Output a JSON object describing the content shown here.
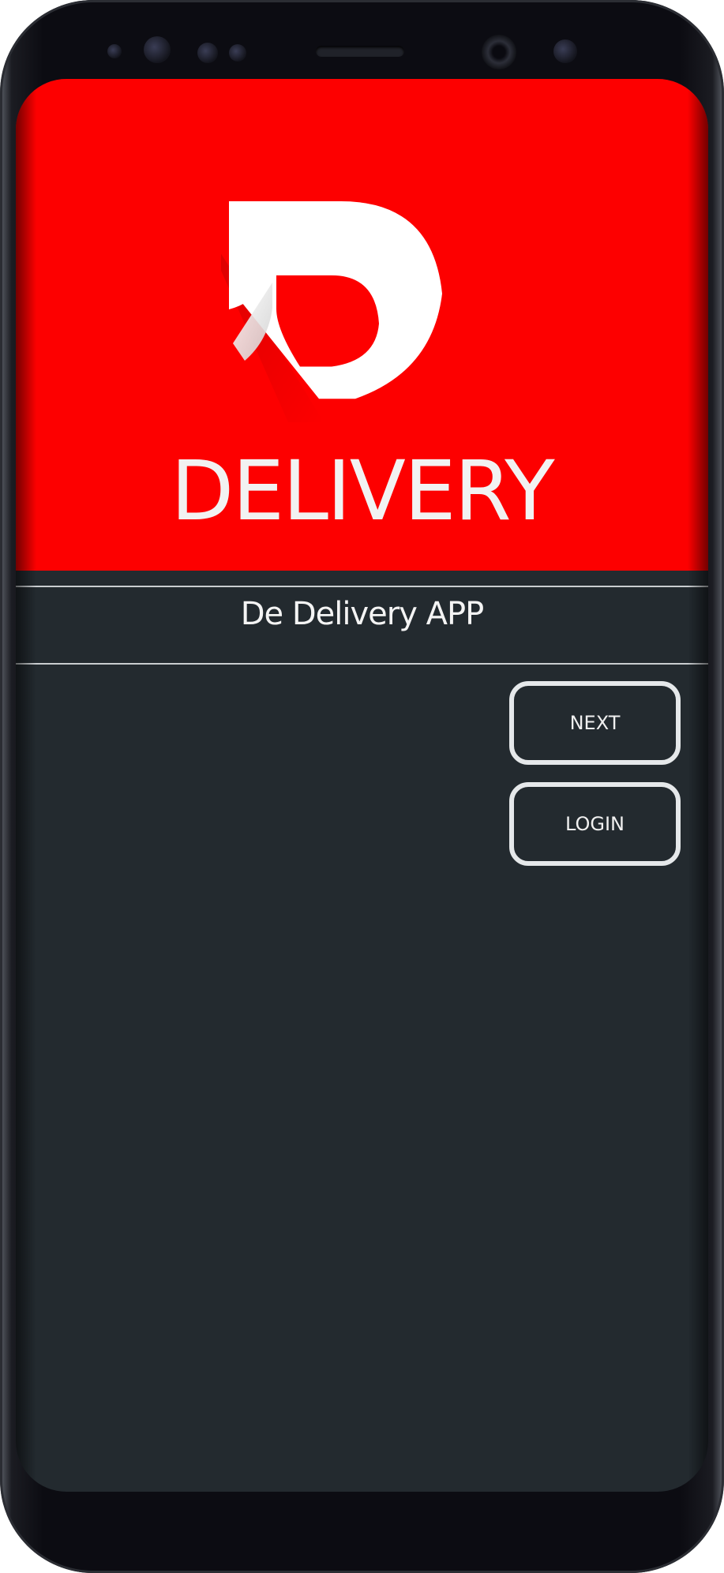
{
  "header": {
    "logo_icon": "d-delivery-logo",
    "brand_word": "DELIVERY",
    "background_color": "#fd0000"
  },
  "app_title": "De Delivery APP",
  "buttons": {
    "next_label": "NEXT",
    "login_label": "LOGIN"
  },
  "theme": {
    "screen_background": "#232a2f",
    "button_border": "#e5e8ea",
    "text_color": "#f2f2f2"
  }
}
